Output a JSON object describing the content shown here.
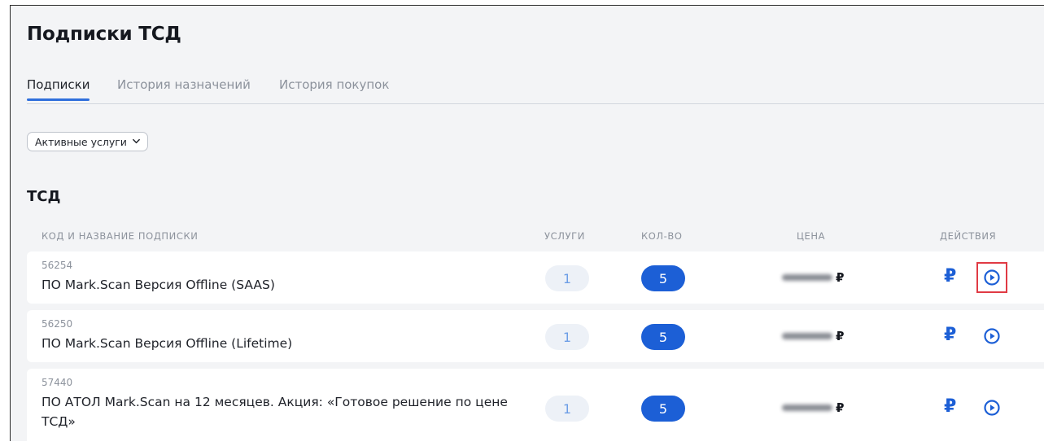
{
  "page": {
    "title": "Подписки ТСД"
  },
  "tabs": [
    {
      "label": "Подписки",
      "active": true
    },
    {
      "label": "История назначений",
      "active": false
    },
    {
      "label": "История покупок",
      "active": false
    }
  ],
  "filter": {
    "selected": "Активные услуги"
  },
  "section": {
    "title": "ТСД"
  },
  "table": {
    "columns": {
      "name": "КОД И НАЗВАНИЕ ПОДПИСКИ",
      "services": "УСЛУГИ",
      "qty": "КОЛ-ВО",
      "price": "ЦЕНА",
      "actions": "ДЕЙСТВИЯ"
    },
    "rows": [
      {
        "code": "56254",
        "name": "ПО Mark.Scan Версия Offline (SAAS)",
        "services": "1",
        "qty": "5",
        "currency": "₽"
      },
      {
        "code": "56250",
        "name": "ПО Mark.Scan Версия Offline (Lifetime)",
        "services": "1",
        "qty": "5",
        "currency": "₽"
      },
      {
        "code": "57440",
        "name": "ПО АТОЛ Mark.Scan на 12 месяцев. Акция: «Готовое решение по цене ТСД»",
        "services": "1",
        "qty": "5",
        "currency": "₽"
      }
    ],
    "action_icons": {
      "buy": "ruble-icon",
      "activate": "play-circle-icon"
    }
  },
  "colors": {
    "accent": "#1c5fd6",
    "highlight": "#e03a44",
    "muted": "#8c929c"
  }
}
